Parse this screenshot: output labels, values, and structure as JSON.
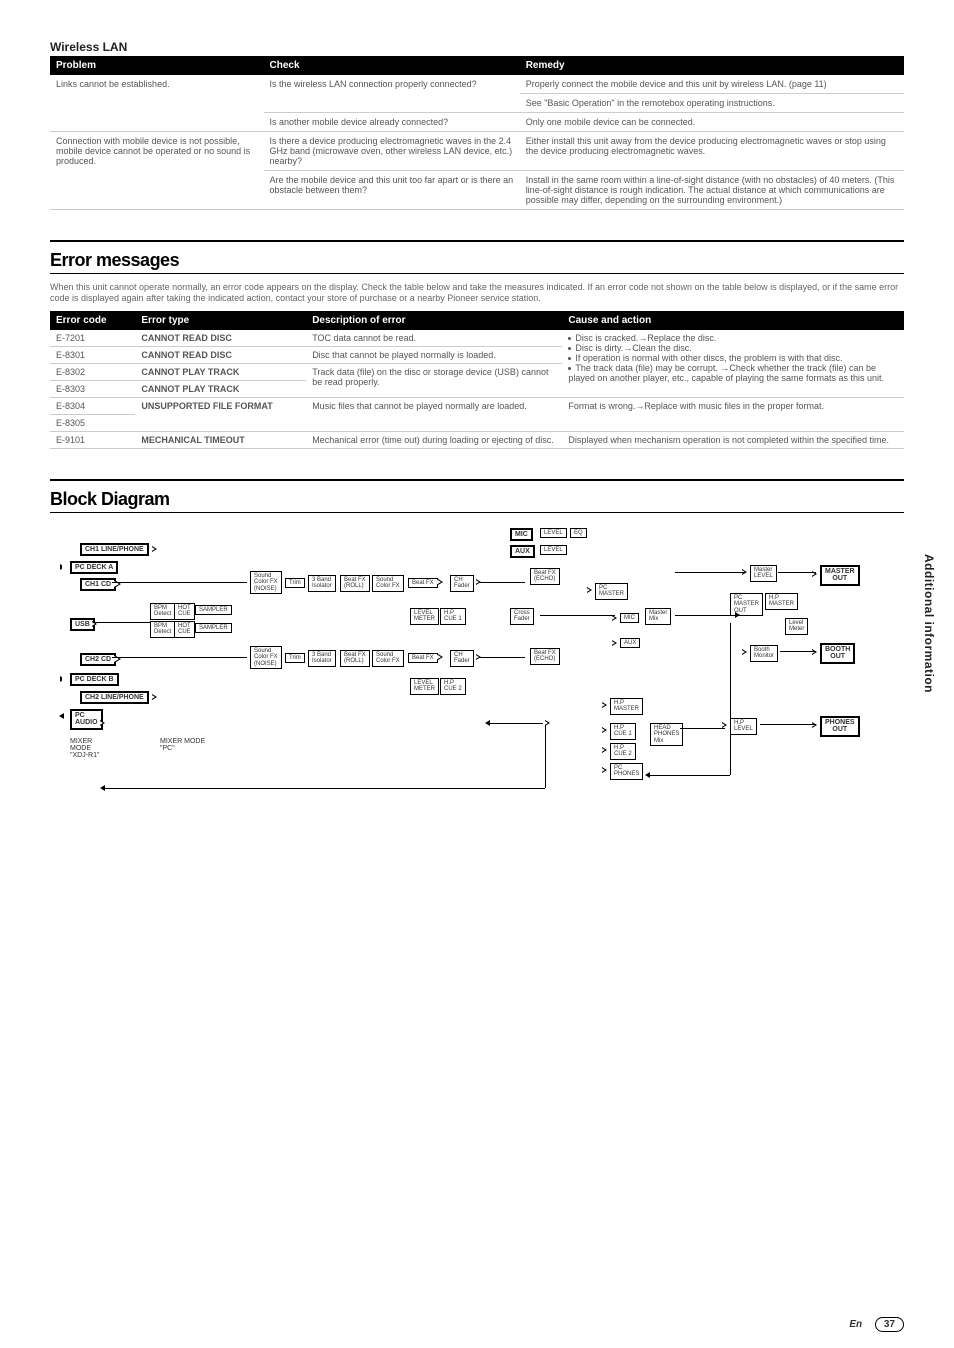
{
  "wireless": {
    "title": "Wireless LAN",
    "headers": {
      "problem": "Problem",
      "check": "Check",
      "remedy": "Remedy"
    },
    "rows": [
      {
        "problem": "Links cannot be established.",
        "check": "Is the wireless LAN connection properly connected?",
        "remedy": "Properly connect the mobile device and this unit by wireless LAN. (page 11)"
      },
      {
        "problem": "",
        "check": "",
        "remedy": "See \"Basic Operation\" in the remotebox operating instructions."
      },
      {
        "problem": "",
        "check": "Is another mobile device already connected?",
        "remedy": "Only one mobile device can be connected."
      },
      {
        "problem": "Connection with mobile device is not possible, mobile device cannot be operated or no sound is produced.",
        "check": "Is there a device producing electromagnetic waves in the 2.4 GHz band (microwave oven, other wireless LAN device, etc.) nearby?",
        "remedy": "Either install this unit away from the device producing electromagnetic waves or stop using the device producing electromagnetic waves."
      },
      {
        "problem": "",
        "check": "Are the mobile device and this unit too far apart or is there an obstacle between them?",
        "remedy": "Install in the same room within a line-of-sight distance (with no obstacles) of 40 meters. (This line-of-sight distance is rough indication. The actual distance at which communications are possible may differ, depending on the surrounding environment.)"
      }
    ]
  },
  "errors": {
    "heading": "Error messages",
    "intro": "When this unit cannot operate normally, an error code appears on the display. Check the table below and take the measures indicated. If an error code not shown on the table below is displayed, or if the same error code is displayed again after taking the indicated action, contact your store of purchase or a nearby Pioneer service station.",
    "headers": {
      "code": "Error code",
      "type": "Error type",
      "desc": "Description of error",
      "cause": "Cause and action"
    },
    "rows": [
      {
        "code": "E-7201",
        "type": "CANNOT READ DISC",
        "desc": "TOC data cannot be read."
      },
      {
        "code": "E-8301",
        "type": "CANNOT READ DISC",
        "desc": "Disc that cannot be played normally is loaded."
      },
      {
        "code": "E-8302",
        "type": "CANNOT PLAY TRACK",
        "desc": "Track data (file) on the disc or storage device (USB) cannot be read properly."
      },
      {
        "code": "E-8303",
        "type": "CANNOT PLAY TRACK",
        "desc": ""
      },
      {
        "code": "E-8304",
        "type": "UNSUPPORTED FILE FORMAT",
        "desc": "Music files that cannot be played normally are loaded.",
        "cause": "Format is wrong.→Replace with music files in the proper format."
      },
      {
        "code": "E-8305",
        "type": "",
        "desc": ""
      },
      {
        "code": "E-9101",
        "type": "MECHANICAL TIMEOUT",
        "desc": "Mechanical error (time out) during loading or ejecting of disc.",
        "cause": "Displayed when mechanism operation is not completed within the specified time."
      }
    ],
    "shared_cause": [
      "Disc is cracked.→Replace the disc.",
      "Disc is dirty.→Clean the disc.",
      "If operation is normal with other discs, the problem is with that disc.",
      "The track data (file) may be corrupt. →Check whether the track (file) can be played on another player, etc., capable of playing the same formats as this unit."
    ]
  },
  "block": {
    "heading": "Block Diagram"
  },
  "side": "Additional information",
  "footer": {
    "en": "En",
    "page": "37"
  },
  "d": {
    "ch1lp": "CH1 LINE/PHONE",
    "pcdecka": "PC DECK A",
    "ch1cd": "CH1 CD",
    "usb": "USB",
    "ch2cd": "CH2 CD",
    "pcdeckb": "PC DECK B",
    "ch2lp": "CH2 LINE/PHONE",
    "pcaudio": "PC\nAUDIO",
    "mixer": "MIXER\nMODE\n\"XDJ-R1\"",
    "mixermode": "MIXER MODE\n\"PC\"",
    "soundcfx1": "Sound\nColor FX\n(NOISE)",
    "soundcfx2": "Sound\nColor FX\n(NOISE)",
    "trim1": "Trim",
    "trim2": "Trim",
    "band1": "3 Band\nIsolator",
    "band2": "3 Band\nIsolator",
    "beatroll1": "Beat FX\n(ROLL)",
    "beatroll2": "Beat FX\n(ROLL)",
    "scfx1": "Sound\nColor FX",
    "scfx2": "Sound\nColor FX",
    "beatfx1": "Beat FX",
    "beatfx2": "Beat FX",
    "chfader1": "CH\nFader",
    "chfader2": "CH\nFader",
    "bpmd": "BPM\nDetect",
    "hotcue": "HOT\nCUE",
    "sampler": "SAMPLER",
    "levelm1": "LEVEL\nMETER",
    "levelm2": "LEVEL\nMETER",
    "hpcue1": "H.P\nCUE 1",
    "hpcue2": "H.P\nCUE 2",
    "mic": "MIC",
    "level": "LEVEL",
    "eq": "EQ",
    "aux": "AUX",
    "beatecho1": "Beat FX\n(ECHO)",
    "beatecho2": "Beat FX\n(ECHO)",
    "crossf": "Cross\nFader",
    "pcmaster": "PC\nMASTER",
    "micbox": "MIC",
    "mastermix": "Master\nMix",
    "auxbox": "AUX",
    "hpmaster": "H.P\nMASTER",
    "hpcue1b": "H.P\nCUE 1",
    "hpcue2b": "H.P\nCUE 2",
    "pcphones": "PC\nPHONES",
    "headphmix": "HEAD\nPHONES\nMix",
    "masterlvl": "Master\nLEVEL",
    "pcmasterout": "PC\nMASTER\nOUT",
    "hpmaster2": "H.P\nMASTER",
    "levelmeter": "Level\nMeter",
    "boothmon": "Booth\nMonitor",
    "hplevel": "H.P\nLEVEL",
    "masterout": "MASTER\nOUT",
    "boothout": "BOOTH\nOUT",
    "phonesout": "PHONES\nOUT"
  }
}
